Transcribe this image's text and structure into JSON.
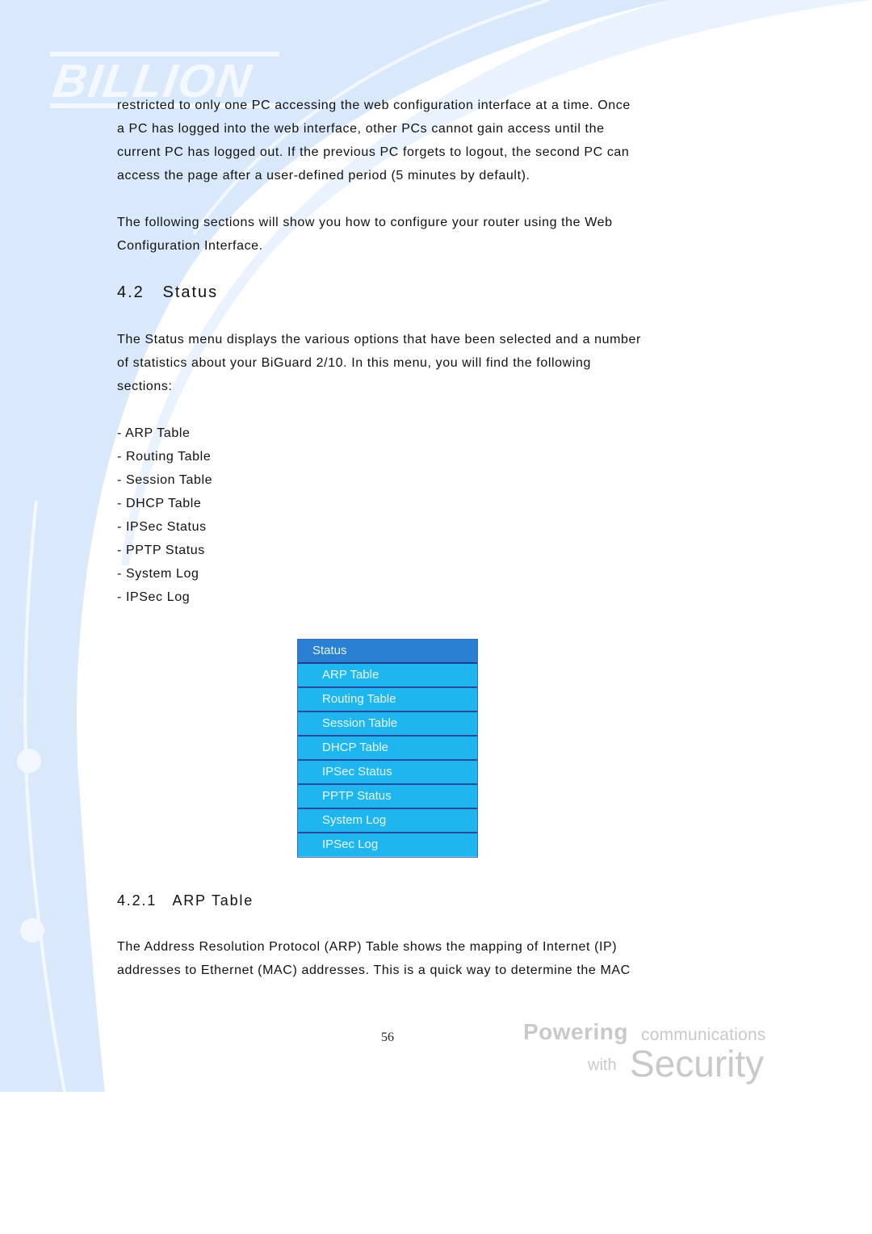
{
  "brand": {
    "logo_text": "BILLION",
    "slogan_line1_bold": "Powering",
    "slogan_line1_light": "communications",
    "slogan_line2_small": "with",
    "slogan_line2_large": "Security"
  },
  "intro": {
    "lines": [
      "restricted to only one PC accessing the web configuration interface at a time. Once",
      "a PC has logged into the web interface, other PCs cannot gain access until the",
      "current PC has logged out. If the previous PC forgets to logout, the second PC can",
      "access the page after a user-defined period (5 minutes by default)."
    ],
    "next_lines": [
      "The following sections will show you how to configure your router using the Web",
      "Configuration Interface."
    ]
  },
  "section": {
    "heading": "4.2   Status",
    "description_lines": [
      "The Status menu displays the various options that have been selected and a number",
      "of statistics about your BiGuard 2/10. In this menu, you will find the following",
      "sections:"
    ],
    "list_items": [
      "- ARP Table",
      "- Routing Table",
      "- Session Table",
      "- DHCP Table",
      "- IPSec Status",
      "- PPTP Status",
      "- System Log",
      "- IPSec Log"
    ]
  },
  "status_menu": {
    "title": "Status",
    "items": [
      "ARP Table",
      "Routing Table",
      "Session Table",
      "DHCP Table",
      "IPSec Status",
      "PPTP Status",
      "System Log",
      "IPSec Log"
    ],
    "colors": {
      "header_bg": "#2a80d2",
      "item_bg": "#1fb6ef",
      "separator": "#274a9b"
    }
  },
  "subsection": {
    "heading": "4.2.1   ARP Table",
    "description_lines": [
      "The Address Resolution Protocol (ARP) Table shows the mapping of Internet (IP)",
      "addresses to Ethernet (MAC) addresses. This is a quick way to determine the MAC"
    ]
  },
  "footer": {
    "page_number": "56"
  }
}
